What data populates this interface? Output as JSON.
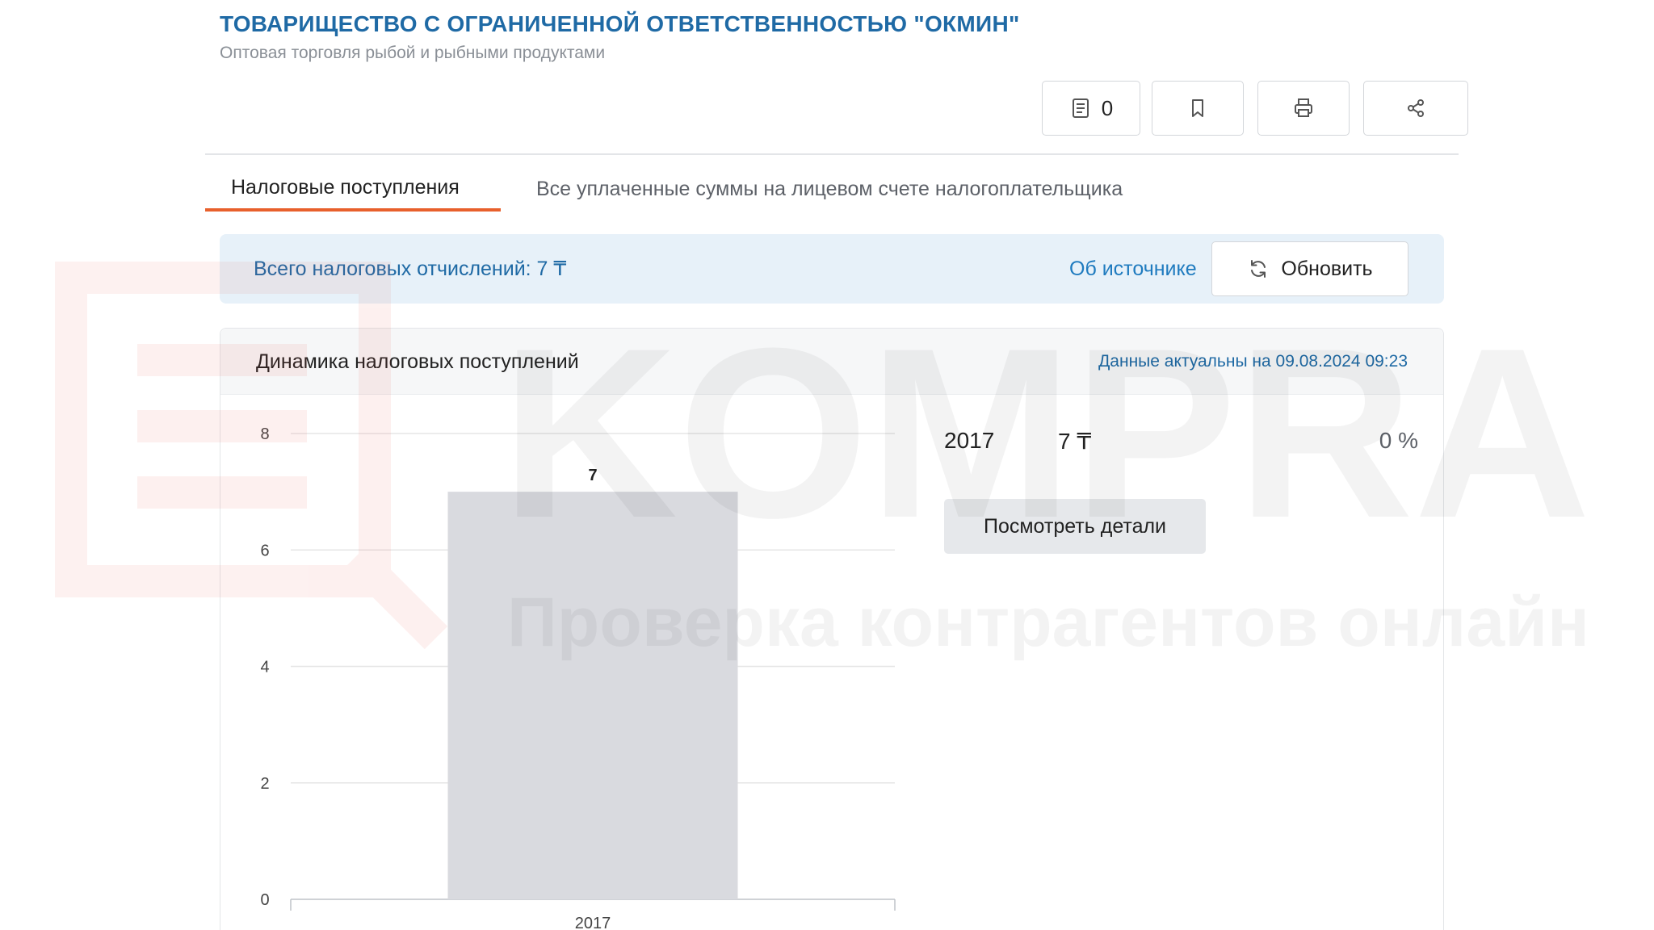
{
  "company": {
    "name": "ТОВАРИЩЕСТВО С ОГРАНИЧЕННОЙ ОТВЕТСТВЕННОСТЬЮ \"ОКМИН\"",
    "activity": "Оптовая торговля рыбой и рыбными продуктами"
  },
  "toolbar": {
    "documents_count": "0",
    "icons": [
      "document-list-icon",
      "bookmark-icon",
      "printer-icon",
      "share-icon"
    ]
  },
  "tabs": [
    {
      "label": "Налоговые поступления",
      "active": true
    },
    {
      "label": "Все уплаченные суммы на лицевом счете налогоплательщика",
      "active": false
    }
  ],
  "summary": {
    "total_label": "Всего налоговых отчислений: 7 ₸",
    "source_link": "Об источнике",
    "refresh_label": "Обновить"
  },
  "chart_panel": {
    "title": "Динамика налоговых поступлений",
    "updated": "Данные актуальны на 09.08.2024 09:23"
  },
  "chart_data": {
    "type": "bar",
    "categories": [
      "2017"
    ],
    "values": [
      7
    ],
    "ylim": [
      0,
      8
    ],
    "yticks": [
      "0",
      "2",
      "4",
      "6",
      "8"
    ],
    "data_labels": [
      "7"
    ],
    "grid": true,
    "bar_color": "#d9dadf"
  },
  "details": {
    "year": "2017",
    "amount": "7 ₸",
    "percent": "0 %",
    "button_label": "Посмотреть детали"
  },
  "watermark": {
    "brand": "KOMPRA",
    "tagline": "Проверка контрагентов онлайн"
  },
  "colors": {
    "accent_blue": "#1f6aa5",
    "tab_underline": "#e8602c",
    "banner_bg": "#e7f1f9"
  }
}
